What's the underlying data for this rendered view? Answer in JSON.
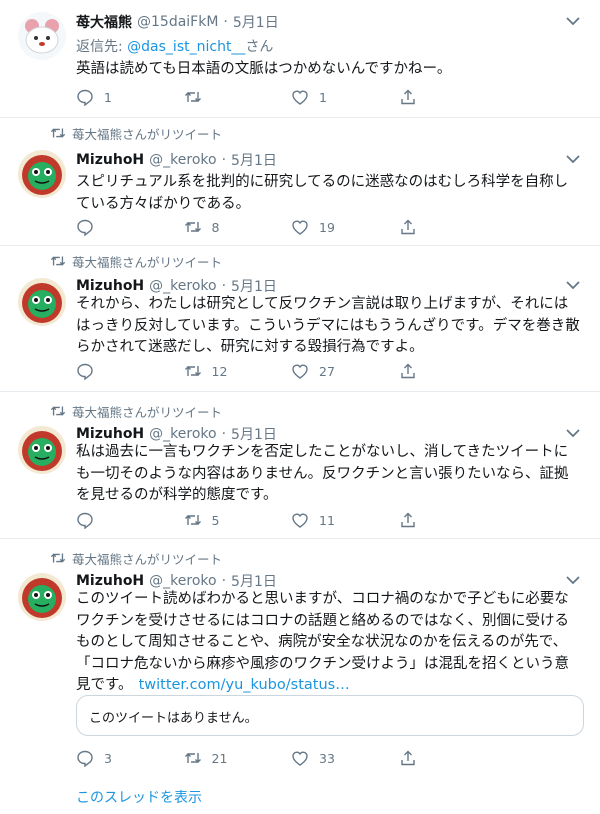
{
  "tweets": [
    {
      "retweet_note": "",
      "name": "苺大福熊",
      "handle": "@15daiFkM",
      "date": "5月1日",
      "reply_prefix": "返信先: ",
      "reply_mention": "@das_ist_nicht__",
      "reply_suffix": "さん",
      "text": "英語は読めても日本語の文脈はつかめないんですかねー。",
      "link": "",
      "replies": "1",
      "retweets": "",
      "likes": "1"
    },
    {
      "retweet_note": "苺大福熊さんがリツイート",
      "name": "MizuhoH",
      "handle": "@_keroko",
      "date": "5月1日",
      "text": "スピリチュアル系を批判的に研究してるのに迷惑なのはむしろ科学を自称している方々ばかりである。",
      "link": "",
      "replies": "",
      "retweets": "8",
      "likes": "19"
    },
    {
      "retweet_note": "苺大福熊さんがリツイート",
      "name": "MizuhoH",
      "handle": "@_keroko",
      "date": "5月1日",
      "text": "それから、わたしは研究として反ワクチン言説は取り上げますが、それにははっきり反対しています。こういうデマにはもううんざりです。デマを巻き散らかされて迷惑だし、研究に対する毀損行為ですよ。",
      "link": "",
      "replies": "",
      "retweets": "12",
      "likes": "27"
    },
    {
      "retweet_note": "苺大福熊さんがリツイート",
      "name": "MizuhoH",
      "handle": "@_keroko",
      "date": "5月1日",
      "text": "私は過去に一言もワクチンを否定したことがないし、消してきたツイートにも一切そのような内容はありません。反ワクチンと言い張りたいなら、証拠を見せるのが科学的態度です。",
      "link": "",
      "replies": "",
      "retweets": "5",
      "likes": "11"
    },
    {
      "retweet_note": "苺大福熊さんがリツイート",
      "name": "MizuhoH",
      "handle": "@_keroko",
      "date": "5月1日",
      "text": "このツイート読めばわかると思いますが、コロナ禍のなかで子どもに必要なワクチンを受けさせるにはコロナの話題と絡めるのではなく、別個に受けるものとして周知させることや、病院が安全な状況なのかを伝えるのが先で、「コロナ危ないから麻疹や風疹のワクチン受けよう」は混乱を招くという意見です。",
      "link": "twitter.com/yu_kubo/status…",
      "quote_unavailable": "このツイートはありません。",
      "replies": "3",
      "retweets": "21",
      "likes": "33"
    }
  ],
  "show_thread": "このスレッドを表示",
  "colors": {
    "link": "#1b95e0",
    "muted": "#657786",
    "text": "#14171a",
    "divider": "#e6ecf0"
  },
  "icons": [
    "reply-icon",
    "retweet-icon",
    "like-icon",
    "share-icon",
    "caret-down-icon",
    "retweet-small-icon"
  ]
}
